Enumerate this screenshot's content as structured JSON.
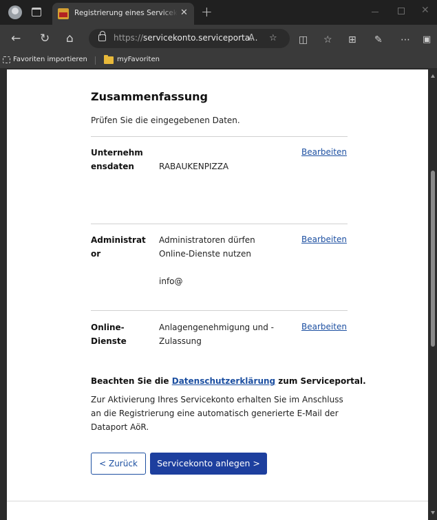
{
  "browser": {
    "tab_title": "Registrierung eines Servicekonto",
    "url_prefix": "https://",
    "url_host": "servicekonto.serviceporta...",
    "favorites": {
      "import_label": "Favoriten importieren",
      "folder_label": "myFavoriten"
    }
  },
  "page": {
    "title": "Zusammenfassung",
    "subtitle": "Prüfen Sie die eingegebenen Daten.",
    "sections": [
      {
        "label": "Unternehmensdaten",
        "value": "RABAUKENPIZZA",
        "edit_label": "Bearbeiten"
      },
      {
        "label": "Administrator",
        "value": "Administratoren dürfen Online-Dienste nutzen",
        "value2": "info@",
        "edit_label": "Bearbeiten"
      },
      {
        "label": "Online-Dienste",
        "value": "Anlagengenehmigung und -Zulassung",
        "edit_label": "Bearbeiten"
      }
    ],
    "notice": {
      "prefix": "Beachten Sie die ",
      "link": "Datenschutzerklärung",
      "suffix": " zum Serviceportal.",
      "text": "Zur Aktivierung Ihres Servicekonto erhalten Sie im Anschluss an die Registrierung eine automatisch generierte E-Mail der Dataport AöR."
    },
    "buttons": {
      "back": "< Zurück",
      "create": "Servicekonto anlegen >"
    }
  }
}
